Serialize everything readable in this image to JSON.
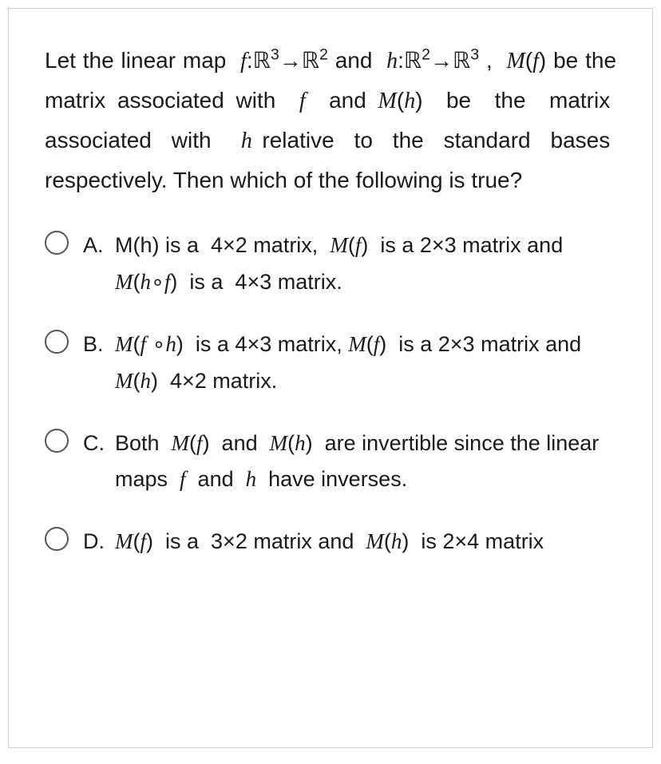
{
  "question_html": "Let the linear map&nbsp; <span class='math-i'>f</span>:<span class='bb'>ℝ</span><sup>3</sup>→<span class='bb'>ℝ</span><sup>2</sup> and&nbsp; <span class='math-i'>h</span>:<span class='bb'>ℝ</span><sup>2</sup>→<span class='bb'>ℝ</span><sup>3</sup> ,&nbsp; <span class='math-i'>M</span>(<span class='math-i'>f</span>) be the matrix associated with&nbsp; <span class='math-i'>f</span>&nbsp; and <span class='math-i'>M</span>(<span class='math-i'>h</span>)&nbsp; be&nbsp; the&nbsp; matrix&nbsp; associated&nbsp; with&nbsp;&nbsp; <span class='math-i'>h</span> relative&nbsp; to&nbsp; the&nbsp; standard&nbsp; bases&nbsp; respectively. Then which of the following is true?",
  "options": [
    {
      "letter": "A.",
      "html": "M(h) is a&nbsp; 4×2 matrix,&nbsp; <span class='math-i'>M</span>(<span class='math-i'>f</span>)&nbsp; is a 2×3 matrix and&nbsp; <span class='math-i'>M</span>(<span class='math-i'>h</span>∘<span class='math-i'>f</span>)&nbsp; is a&nbsp; 4×3 matrix."
    },
    {
      "letter": "B.",
      "html": "<span class='math-i'>M</span>(<span class='math-i'>f</span> ∘<span class='math-i'>h</span>)&nbsp; is a 4×3 matrix, <span class='math-i'>M</span>(<span class='math-i'>f</span>)&nbsp; is a 2×3 matrix and&nbsp; <span class='math-i'>M</span>(<span class='math-i'>h</span>)&nbsp; 4×2 matrix."
    },
    {
      "letter": "C.",
      "html": "Both&nbsp; <span class='math-i'>M</span>(<span class='math-i'>f</span>)&nbsp; and&nbsp; <span class='math-i'>M</span>(<span class='math-i'>h</span>)&nbsp; are invertible since the linear maps&nbsp; <span class='math-i'>f</span>&nbsp; and&nbsp; <span class='math-i'>h</span>&nbsp; have inverses."
    },
    {
      "letter": "D.",
      "html": "<span class='math-i'>M</span>(<span class='math-i'>f</span>)&nbsp; is a&nbsp; 3×2 matrix and&nbsp; <span class='math-i'>M</span>(<span class='math-i'>h</span>)&nbsp; is 2×4 matrix"
    }
  ]
}
